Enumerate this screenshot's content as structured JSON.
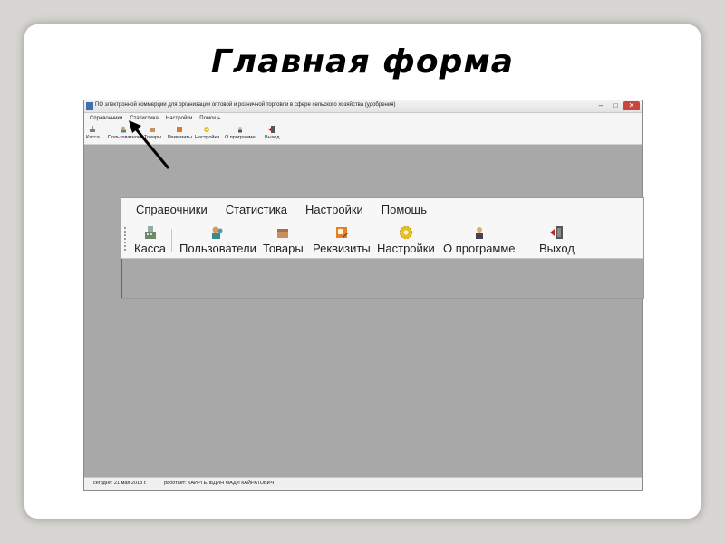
{
  "slide": {
    "title": "Главная форма"
  },
  "window": {
    "title": "ПО электронной коммерции для организации оптовой и розничной торговли в сфере сельского хозяйства (удобрения)",
    "menu": [
      "Справочники",
      "Статистика",
      "Настройки",
      "Помощь"
    ],
    "toolbar": [
      "Касса",
      "Пользователи",
      "Товары",
      "Реквизиты",
      "Настройки",
      "О программе",
      "Выход"
    ],
    "status_date": "сегодня: 21 мая 2018 г.",
    "status_user": "работает: КАИРГЕЛЬДИН МАДИ КАЙРАТОВИЧ"
  },
  "zoom": {
    "menu": [
      "Справочники",
      "Статистика",
      "Настройки",
      "Помощь"
    ],
    "toolbar": [
      "Касса",
      "Пользователи",
      "Товары",
      "Реквизиты",
      "Настройки",
      "О программе",
      "Выход"
    ]
  },
  "icons": {
    "kassa": "cash-register-icon",
    "users": "users-icon",
    "goods": "box-icon",
    "requisites": "document-edit-icon",
    "settings": "gear-icon",
    "about": "info-person-icon",
    "exit": "exit-door-icon"
  },
  "colors": {
    "slide_bg": "#d8d6d2",
    "workspace": "#a8a8a8",
    "close_button": "#c9463d"
  }
}
